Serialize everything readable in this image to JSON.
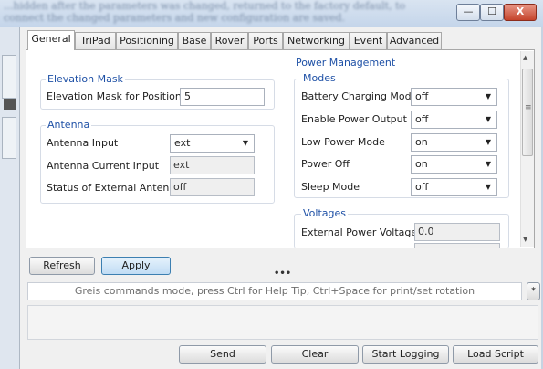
{
  "window": {
    "blurred_title": "...hidden after the parameters was changed, returned to the factory default, to connect the changed parameters and new configuration are saved.",
    "minimize_label": "—",
    "maximize_label": "☐",
    "close_label": "X"
  },
  "tabs": [
    "General",
    "TriPad",
    "Positioning",
    "Base",
    "Rover",
    "Ports",
    "Networking",
    "Event",
    "Advanced"
  ],
  "active_tab": "General",
  "elevation_mask": {
    "title": "Elevation Mask",
    "label": "Elevation Mask for Position...",
    "value": "5"
  },
  "antenna": {
    "title": "Antenna",
    "input_label": "Antenna Input",
    "input_value": "ext",
    "current_label": "Antenna Current Input",
    "current_value": "ext",
    "status_label": "Status of External Antenna",
    "status_value": "off"
  },
  "power": {
    "title": "Power Management",
    "modes_title": "Modes",
    "modes": [
      {
        "label": "Battery Charging Mode",
        "value": "off"
      },
      {
        "label": "Enable Power Output",
        "value": "off"
      },
      {
        "label": "Low Power Mode",
        "value": "on"
      },
      {
        "label": "Power Off",
        "value": "on"
      },
      {
        "label": "Sleep Mode",
        "value": "off"
      }
    ],
    "voltages_title": "Voltages",
    "ext_voltage_label": "External Power Voltage",
    "ext_voltage_value": "0.0"
  },
  "actions": {
    "refresh": "Refresh",
    "apply": "Apply"
  },
  "splitter": "•••",
  "command": {
    "placeholder": "Greis commands mode, press Ctrl for Help Tip, Ctrl+Space for print/set rotation",
    "side_button": "*"
  },
  "bottom": {
    "send": "Send",
    "clear": "Clear",
    "start_logging": "Start Logging",
    "load_script": "Load Script"
  }
}
